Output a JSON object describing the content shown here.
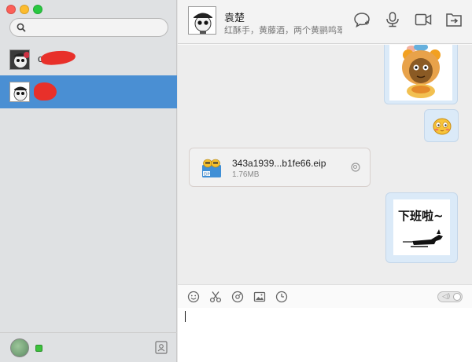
{
  "window": {
    "traffic_lights": [
      {
        "name": "close",
        "color": "#fc5f57"
      },
      {
        "name": "minimize",
        "color": "#fdbc2e"
      },
      {
        "name": "zoom",
        "color": "#28c840"
      }
    ]
  },
  "sidebar": {
    "search": {
      "placeholder": "",
      "value": "",
      "icon": "search-icon"
    },
    "conversations": [
      {
        "name": "c",
        "selected": false,
        "avatar": "panda-avatar"
      },
      {
        "name": "",
        "selected": true,
        "avatar": "panda-avatar"
      }
    ],
    "bottom": {
      "status_color": "#3cc23c",
      "contacts_icon": "contacts-icon"
    },
    "selected_color": "#4a8fd3"
  },
  "chat": {
    "header": {
      "title": "袁楚",
      "signature": "红酥手，黄藤酒，两个黄鹂鸣翠柳",
      "icons": [
        "chat-bubble-icon",
        "microphone-icon",
        "video-camera-icon",
        "send-file-icon"
      ]
    },
    "messages": [
      {
        "type": "sticker",
        "side": "right",
        "sticker": "cartoon-character"
      },
      {
        "type": "emoji",
        "side": "right",
        "emoji": "blush-emoji"
      },
      {
        "type": "file",
        "side": "left",
        "filename": "343a1939...b1fe66.eip",
        "size": "1.76MB",
        "icon": "eip-file-icon"
      },
      {
        "type": "sticker",
        "side": "right",
        "sticker": "off-work-sticker",
        "caption": "下班啦~"
      }
    ],
    "toolbar": {
      "tools": [
        "emoji-icon",
        "scissors-icon",
        "history-icon",
        "image-icon",
        "clock-icon"
      ]
    },
    "input": {
      "value": ""
    }
  }
}
